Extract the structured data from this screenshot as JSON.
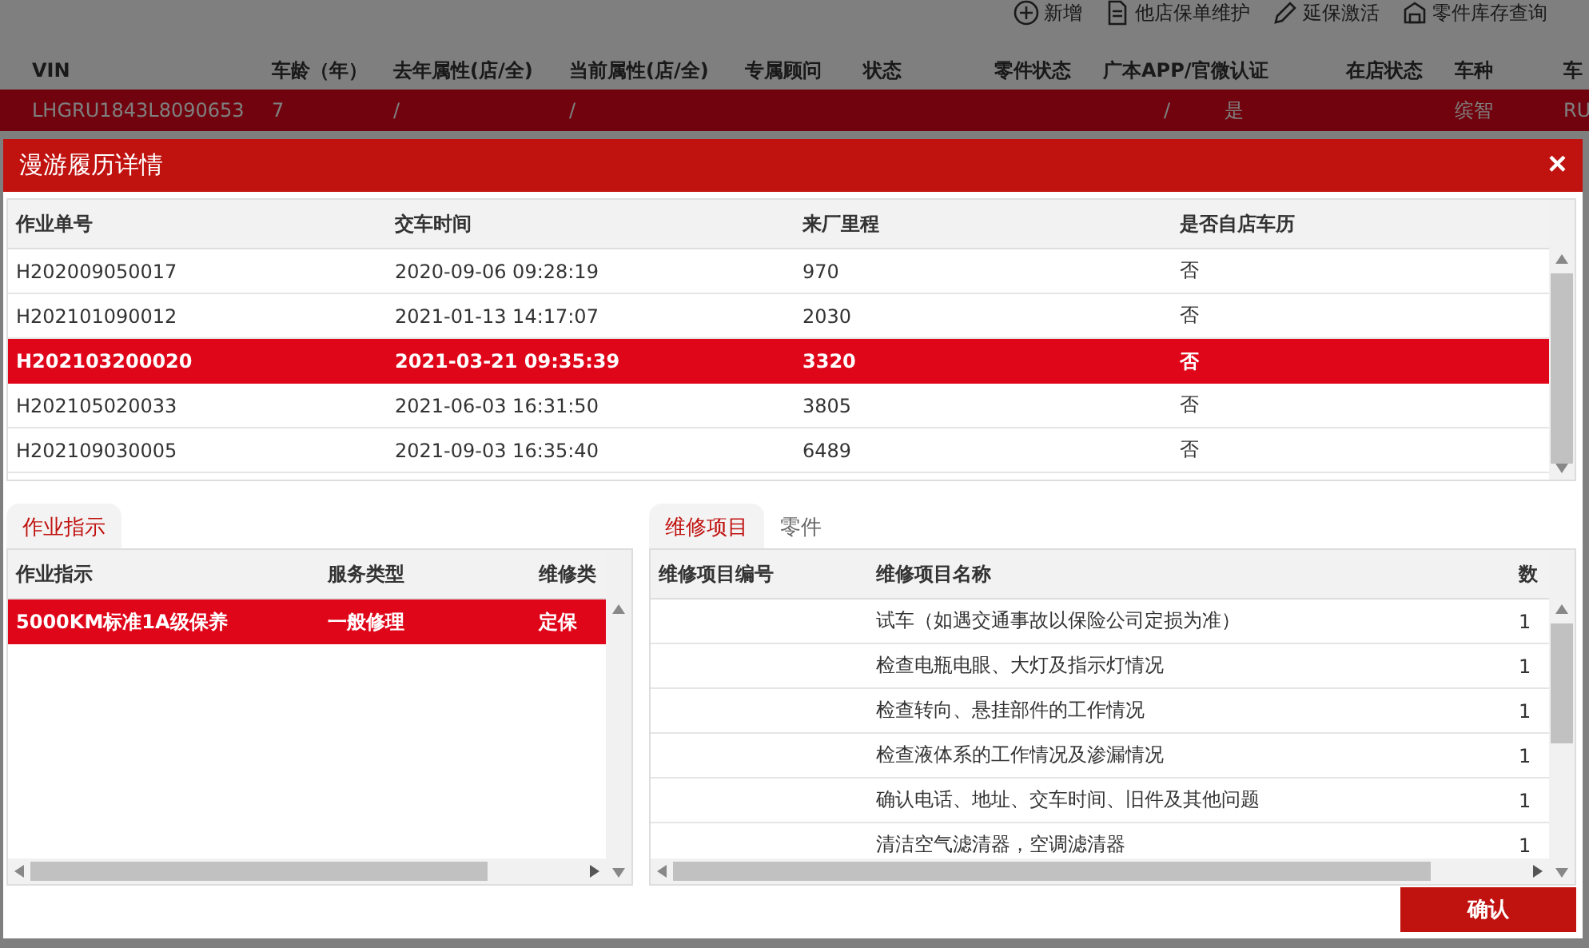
{
  "toolbar": [
    {
      "label": "新增"
    },
    {
      "label": "他店保单维护"
    },
    {
      "label": "延保激活"
    },
    {
      "label": "零件库存查询"
    }
  ],
  "background_table": {
    "columns": [
      "VIN",
      "车龄（年）",
      "去年属性(店/全)",
      "当前属性(店/全)",
      "专属顾问",
      "状态",
      "零件状态",
      "广本APP/官微认证",
      "在店状态",
      "车种",
      "车"
    ],
    "rows": [
      {
        "selected": true,
        "cells": [
          "LHGRU1843L8090653",
          "7",
          "/",
          "/",
          "",
          "",
          "",
          "/ 是",
          "",
          "缤智",
          "RU"
        ]
      }
    ]
  },
  "dialog": {
    "title": "漫游履历详情",
    "close": "×",
    "history": {
      "columns": [
        "作业单号",
        "交车时间",
        "来厂里程",
        "是否自店车历"
      ],
      "rows": [
        {
          "selected": false,
          "cells": [
            "H202009050017",
            "2020-09-06 09:28:19",
            "970",
            "否"
          ]
        },
        {
          "selected": false,
          "cells": [
            "H202101090012",
            "2021-01-13 14:17:07",
            "2030",
            "否"
          ]
        },
        {
          "selected": true,
          "cells": [
            "H202103200020",
            "2021-03-21 09:35:39",
            "3320",
            "否"
          ]
        },
        {
          "selected": false,
          "cells": [
            "H202105020033",
            "2021-06-03 16:31:50",
            "3805",
            "否"
          ]
        },
        {
          "selected": false,
          "cells": [
            "H202109030005",
            "2021-09-03 16:35:40",
            "6489",
            "否"
          ]
        }
      ]
    },
    "instructions": {
      "tabs": [
        {
          "label": "作业指示",
          "selected": true
        }
      ],
      "columns": [
        "作业指示",
        "服务类型",
        "维修类"
      ],
      "rows": [
        {
          "selected": true,
          "cells": [
            "5000KM标准1A级保养",
            "一般修理",
            "定保"
          ]
        }
      ]
    },
    "repairs": {
      "tabs": [
        {
          "label": "维修项目",
          "selected": true
        },
        {
          "label": "零件",
          "selected": false
        }
      ],
      "columns": [
        "维修项目编号",
        "维修项目名称",
        "数"
      ],
      "rows": [
        {
          "selected": false,
          "cells": [
            "",
            "试车（如遇交通事故以保险公司定损为准）",
            "1"
          ]
        },
        {
          "selected": false,
          "cells": [
            "",
            "检查电瓶电眼、大灯及指示灯情况",
            "1"
          ]
        },
        {
          "selected": false,
          "cells": [
            "",
            "检查转向、悬挂部件的工作情况",
            "1"
          ]
        },
        {
          "selected": false,
          "cells": [
            "",
            "检查液体系的工作情况及渗漏情况",
            "1"
          ]
        },
        {
          "selected": false,
          "cells": [
            "",
            "确认电话、地址、交车时间、旧件及其他问题",
            "1"
          ]
        },
        {
          "selected": false,
          "cells": [
            "",
            "清洁空气滤清器，空调滤清器",
            "1"
          ]
        }
      ]
    },
    "confirm": "确认"
  }
}
